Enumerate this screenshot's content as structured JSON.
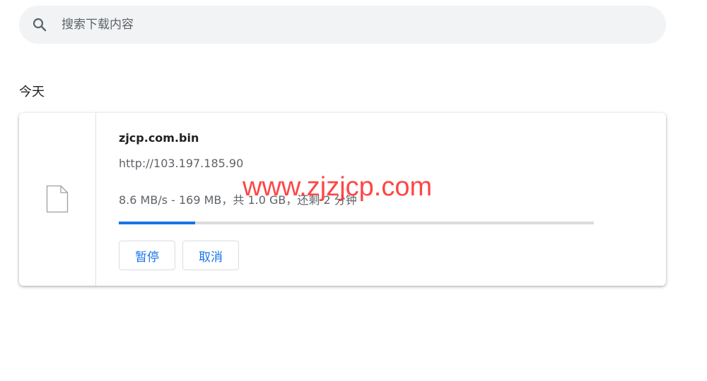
{
  "search": {
    "placeholder": "搜索下载内容",
    "icon": "search-icon"
  },
  "section": {
    "date_label": "今天"
  },
  "download": {
    "icon": "file-icon",
    "file_name": "zjcp.com.bin",
    "url": "http://103.197.185.90",
    "status": "8.6 MB/s - 169 MB，共 1.0 GB，还剩 2 分钟",
    "progress": 0.16,
    "pause_label": "暂停",
    "cancel_label": "取消"
  },
  "watermark": {
    "text": "www.zjzjcp.com"
  },
  "colors": {
    "accent": "#1a73e8",
    "watermark": "#ff2d2d",
    "search_bg": "#f1f3f4"
  }
}
